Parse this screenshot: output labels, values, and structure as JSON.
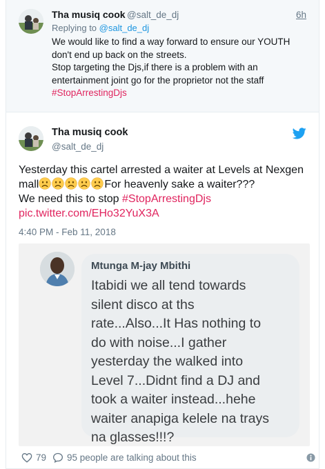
{
  "parent_tweet": {
    "author_name": "Tha musiq cook",
    "author_handle": "@salt_de_dj",
    "time": "6h",
    "replying_prefix": "Replying to",
    "replying_handle": "@salt_de_dj",
    "lines": [
      "We would like to find a way forward to ensure our YOUTH",
      "don't end up back on the streets.",
      "Stop targeting the Djs,if there is a problem with an",
      "entertainment joint go for the proprietor not the staff"
    ],
    "hashtag": "#StopArrestingDjs"
  },
  "tweet": {
    "author_name": "Tha musiq cook",
    "author_handle": "@salt_de_dj",
    "line1": "Yesterday this cartel arrested a waiter at Levels at Nexgen",
    "line2_start": "mall",
    "line2_end": "For heavenly sake a waiter???",
    "line3_start": "We need this to stop ",
    "hashtag": "#StopArrestingDjs",
    "link": "pic.twitter.com/EHo32YuX3A",
    "timestamp": "4:40 PM - Feb 11, 2018",
    "emoji_name": "frowning-face-icon",
    "emoji_count": 5
  },
  "media": {
    "sender": "Mtunga M-jay Mbithi",
    "lines": [
      "Itabidi we all tend towards",
      "silent disco at ths",
      "rate...Also...It Has nothing to",
      "do with noise...I gather",
      "yesterday the walked into",
      "Level 7...Didnt find a DJ and",
      "took a waiter instead...hehe",
      "waiter anapiga kelele na trays",
      "na glasses!!!?"
    ]
  },
  "footer": {
    "likes": "79",
    "talking": "95 people are talking about this"
  },
  "colors": {
    "link_blue": "#1b95e0",
    "hashtag_red": "#e0245e",
    "twitter_blue": "#1da1f2",
    "muted": "#657786"
  }
}
